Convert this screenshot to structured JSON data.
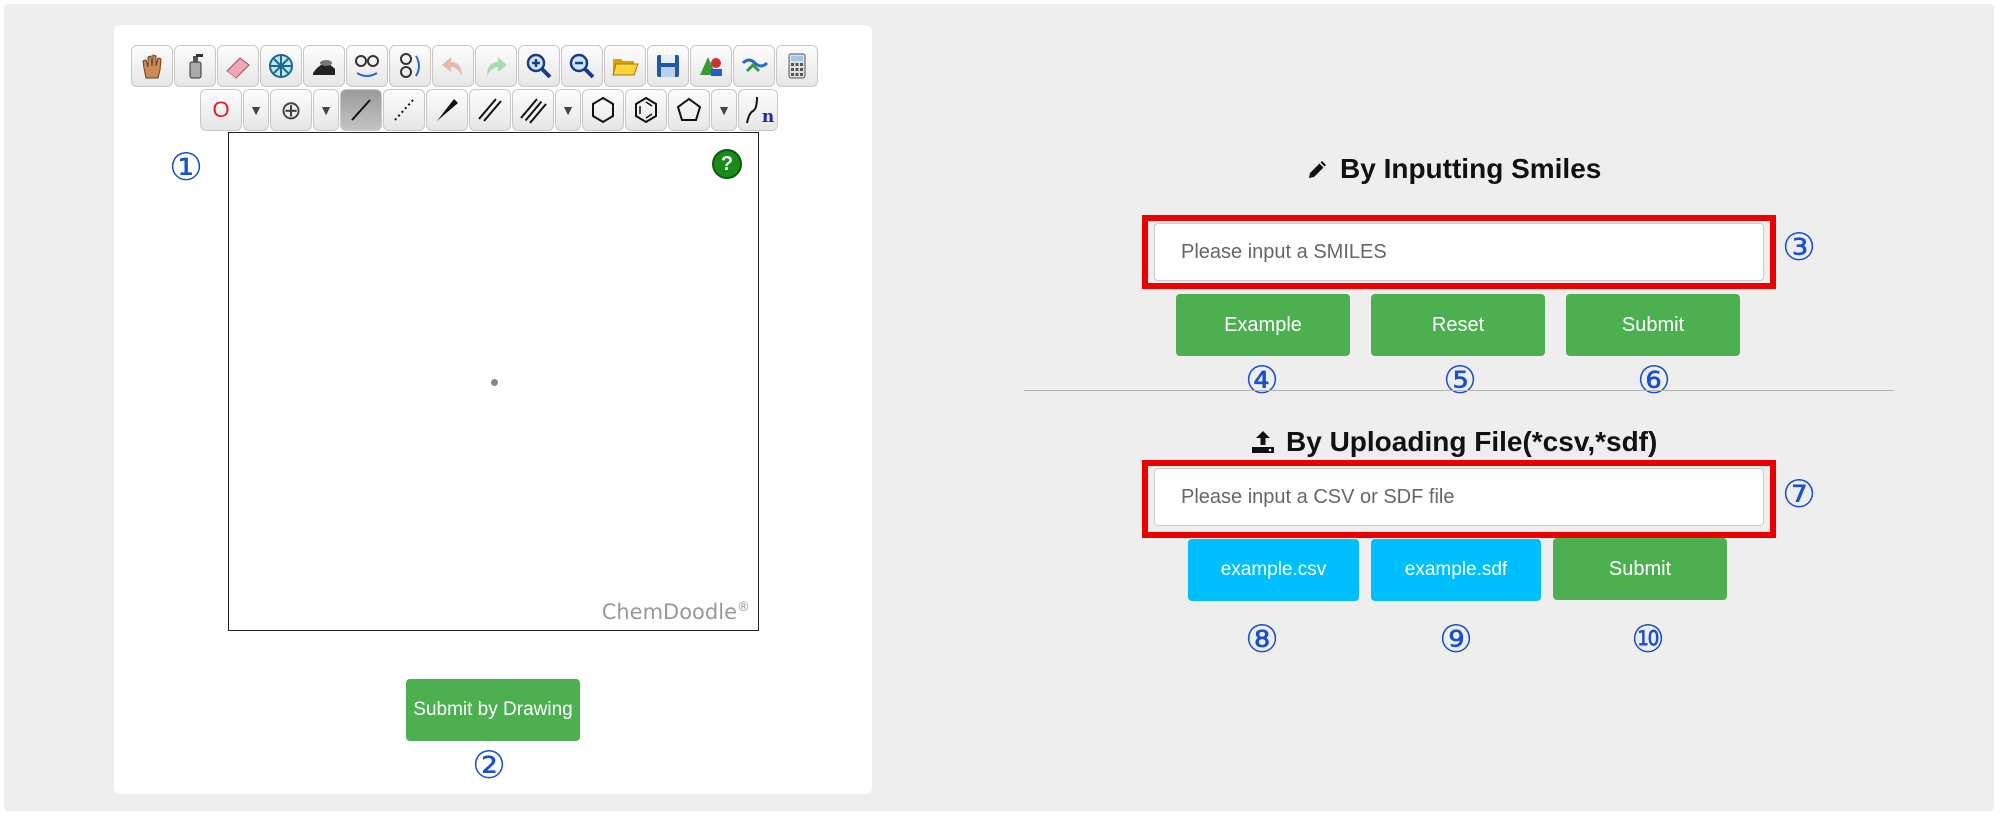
{
  "toolbar": {
    "row1": [
      {
        "icon": "hand-icon"
      },
      {
        "icon": "spray-icon"
      },
      {
        "icon": "eraser-icon"
      },
      {
        "icon": "center-icon"
      },
      {
        "icon": "clean-icon"
      },
      {
        "icon": "flip-horizontal-icon"
      },
      {
        "icon": "flip-vertical-icon"
      },
      {
        "icon": "undo-icon"
      },
      {
        "icon": "redo-icon"
      },
      {
        "icon": "zoom-in-icon"
      },
      {
        "icon": "zoom-out-icon"
      },
      {
        "icon": "open-folder-icon"
      },
      {
        "icon": "save-icon"
      },
      {
        "icon": "templates-icon"
      },
      {
        "icon": "search-icon"
      },
      {
        "icon": "calculator-icon"
      }
    ],
    "row2": {
      "atom_label": "O",
      "chain_label": "n"
    }
  },
  "canvas": {
    "help_label": "?",
    "brand": "ChemDoodle",
    "brand_mark": "®"
  },
  "draw_submit_label": "Submit by Drawing",
  "markers": {
    "m1": "①",
    "m2": "②",
    "m3": "③",
    "m4": "④",
    "m5": "⑤",
    "m6": "⑥",
    "m7": "⑦",
    "m8": "⑧",
    "m9": "⑨",
    "m10": "⑩"
  },
  "smiles_section": {
    "heading": "By Inputting Smiles",
    "placeholder": "Please input a SMILES",
    "example_label": "Example",
    "reset_label": "Reset",
    "submit_label": "Submit"
  },
  "upload_section": {
    "heading": "By Uploading File(*csv,*sdf)",
    "placeholder": "Please input a CSV or SDF file",
    "example_csv_label": "example.csv",
    "example_sdf_label": "example.sdf",
    "submit_label": "Submit"
  },
  "colors": {
    "green": "#4caf50",
    "blue": "#00bfff",
    "highlight_red": "#ee0000",
    "marker_blue": "#1a4fd0"
  }
}
